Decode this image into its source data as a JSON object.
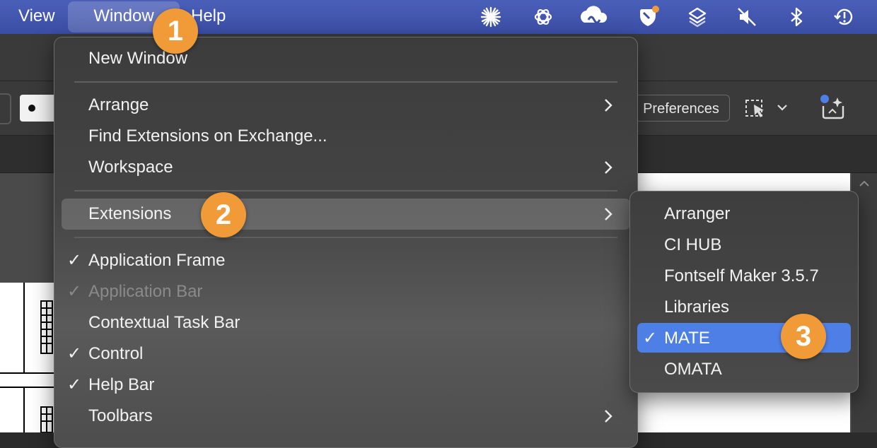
{
  "menubar": {
    "items": [
      "View",
      "Window",
      "Help"
    ],
    "status_icons": [
      "perplexity-icon",
      "openai-icon",
      "creative-cloud-icon",
      "notification-app-icon",
      "layers-app-icon",
      "mute-icon",
      "bluetooth-icon",
      "time-machine-icon"
    ]
  },
  "toolbar": {
    "preferences_label": "Preferences",
    "accent": "#f19b38"
  },
  "window_menu": {
    "new_window": "New Window",
    "arrange": "Arrange",
    "find_extensions": "Find Extensions on Exchange...",
    "workspace": "Workspace",
    "extensions": "Extensions",
    "application_frame": "Application Frame",
    "application_bar": "Application Bar",
    "contextual_task_bar": "Contextual Task Bar",
    "control": "Control",
    "help_bar": "Help Bar",
    "toolbars": "Toolbars",
    "check": "✓"
  },
  "extensions_submenu": {
    "items": [
      "Arranger",
      "CI HUB",
      "Fontself Maker 3.5.7",
      "Libraries",
      "MATE",
      "OMATA"
    ],
    "checked": "MATE",
    "highlight_color": "#4e7fe6"
  },
  "steps": [
    "1",
    "2",
    "3"
  ]
}
